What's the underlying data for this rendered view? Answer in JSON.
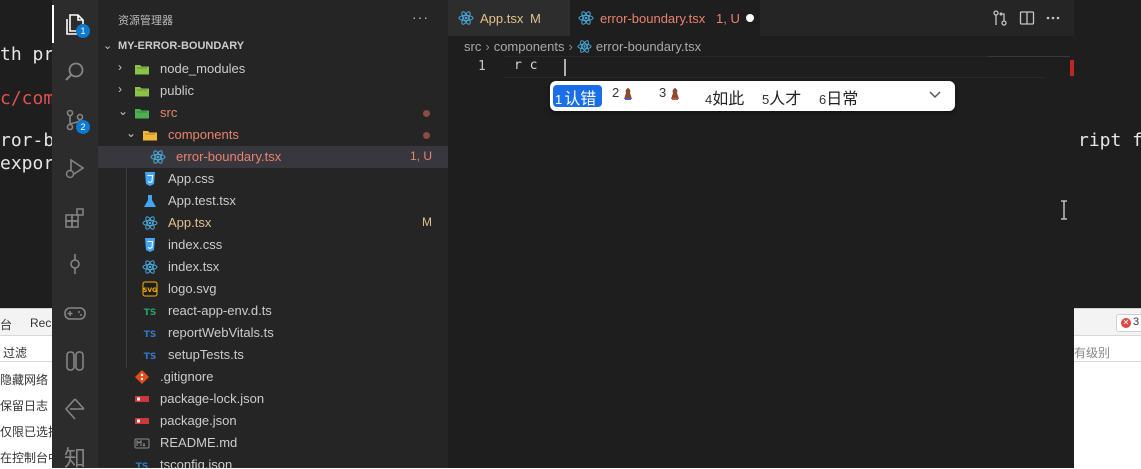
{
  "background": {
    "lines": [
      "th pro",
      "c/comp",
      "ror-bo",
      "export",
      "ript fi"
    ],
    "devtools": {
      "tab_left": "台",
      "tab_rec": "Rec",
      "filter_label": "过滤",
      "options": [
        "隐藏网络",
        "保留日志",
        "仅限已选择",
        "在控制台中"
      ],
      "level_label": "有级别",
      "error_count": "3"
    }
  },
  "activity_bar": {
    "items": [
      {
        "name": "explorer",
        "badge": "1"
      },
      {
        "name": "search"
      },
      {
        "name": "source-control",
        "badge": "2"
      },
      {
        "name": "run-debug"
      },
      {
        "name": "extensions"
      },
      {
        "name": "timeline"
      },
      {
        "name": "gamepad"
      },
      {
        "name": "remote"
      },
      {
        "name": "gitlens"
      },
      {
        "name": "translate",
        "label": "知"
      }
    ]
  },
  "sidebar": {
    "title": "资源管理器",
    "more": "···",
    "root": "MY-ERROR-BOUNDARY",
    "items": [
      {
        "label": "node_modules",
        "type": "folder",
        "icon": "folder-node-icon",
        "icon_color": "#8bc34a",
        "text_color": "#cccccc",
        "chevron": "›",
        "deco": ""
      },
      {
        "label": "public",
        "type": "folder",
        "icon": "folder-public-icon",
        "icon_color": "#8bc34a",
        "text_color": "#cccccc",
        "chevron": "›",
        "deco": ""
      },
      {
        "label": "src",
        "type": "folder-open",
        "icon": "folder-src-icon",
        "icon_color": "#4caf50",
        "text_color": "#e8836f",
        "chevron": "⌄",
        "deco": "dot"
      },
      {
        "label": "components",
        "type": "folder-open",
        "icon": "folder-components-icon",
        "icon_color": "#f0b73a",
        "text_color": "#e8836f",
        "chevron": "⌄",
        "deco": "dot"
      },
      {
        "label": "error-boundary.tsx",
        "type": "file",
        "icon": "react-icon",
        "icon_color": "#4aa8d8",
        "text_color": "#e8836f",
        "deco": "1, U"
      },
      {
        "label": "App.css",
        "type": "file",
        "icon": "css-icon",
        "icon_color": "#42a5f5",
        "text_color": "#cccccc",
        "deco": ""
      },
      {
        "label": "App.test.tsx",
        "type": "file",
        "icon": "test-icon",
        "icon_color": "#42a5f5",
        "text_color": "#cccccc",
        "deco": ""
      },
      {
        "label": "App.tsx",
        "type": "file",
        "icon": "react-icon",
        "icon_color": "#4aa8d8",
        "text_color": "#e2c08d",
        "deco": "M"
      },
      {
        "label": "index.css",
        "type": "file",
        "icon": "css-icon",
        "icon_color": "#42a5f5",
        "text_color": "#cccccc",
        "deco": ""
      },
      {
        "label": "index.tsx",
        "type": "file",
        "icon": "react-icon",
        "icon_color": "#4aa8d8",
        "text_color": "#cccccc",
        "deco": ""
      },
      {
        "label": "logo.svg",
        "type": "file",
        "icon": "svg-icon",
        "icon_color": "#ffb300",
        "text_color": "#cccccc",
        "deco": ""
      },
      {
        "label": "react-app-env.d.ts",
        "type": "file",
        "icon": "ts-def-icon",
        "icon_color": "#26a269",
        "text_color": "#cccccc",
        "deco": ""
      },
      {
        "label": "reportWebVitals.ts",
        "type": "file",
        "icon": "ts-icon",
        "icon_color": "#3178c6",
        "text_color": "#cccccc",
        "deco": ""
      },
      {
        "label": "setupTests.ts",
        "type": "file",
        "icon": "ts-icon",
        "icon_color": "#3178c6",
        "text_color": "#cccccc",
        "deco": ""
      },
      {
        "label": ".gitignore",
        "type": "file",
        "icon": "git-icon",
        "icon_color": "#e64a19",
        "text_color": "#cccccc",
        "deco": ""
      },
      {
        "label": "package-lock.json",
        "type": "file",
        "icon": "npm-icon",
        "icon_color": "#cb3837",
        "text_color": "#cccccc",
        "deco": ""
      },
      {
        "label": "package.json",
        "type": "file",
        "icon": "npm-icon",
        "icon_color": "#cb3837",
        "text_color": "#cccccc",
        "deco": ""
      },
      {
        "label": "README.md",
        "type": "file",
        "icon": "markdown-icon",
        "icon_color": "#8a8a8a",
        "text_color": "#cccccc",
        "deco": ""
      },
      {
        "label": "tsconfig.json",
        "type": "file",
        "icon": "ts-icon",
        "icon_color": "#3178c6",
        "text_color": "#cccccc",
        "deco": ""
      }
    ]
  },
  "tabs": [
    {
      "label": "App.tsx",
      "deco": "M",
      "label_color": "#e2c08d",
      "deco_color": "#e2c08d"
    },
    {
      "label": "error-boundary.tsx",
      "deco": "1, U",
      "label_color": "#e8836f",
      "deco_color": "#e8836f",
      "dirty": true
    }
  ],
  "breadcrumb": [
    "src",
    "components",
    "error-boundary.tsx"
  ],
  "editor": {
    "line_number": "1",
    "code": "r c"
  },
  "ime": {
    "candidates": [
      {
        "num": "1",
        "text": "认错",
        "selected": true
      },
      {
        "num": "2",
        "text": "",
        "glyph": "candidate-glyph-icon"
      },
      {
        "num": "3",
        "text": "",
        "glyph": "candidate-glyph-icon"
      },
      {
        "num": "4",
        "text": "如此"
      },
      {
        "num": "5",
        "text": "人才"
      },
      {
        "num": "6",
        "text": "日常"
      }
    ]
  },
  "colors": {
    "accent": "#1a6ee8",
    "badge": "#0b7ad1",
    "modified": "#e2c08d",
    "untracked": "#e8836f"
  }
}
